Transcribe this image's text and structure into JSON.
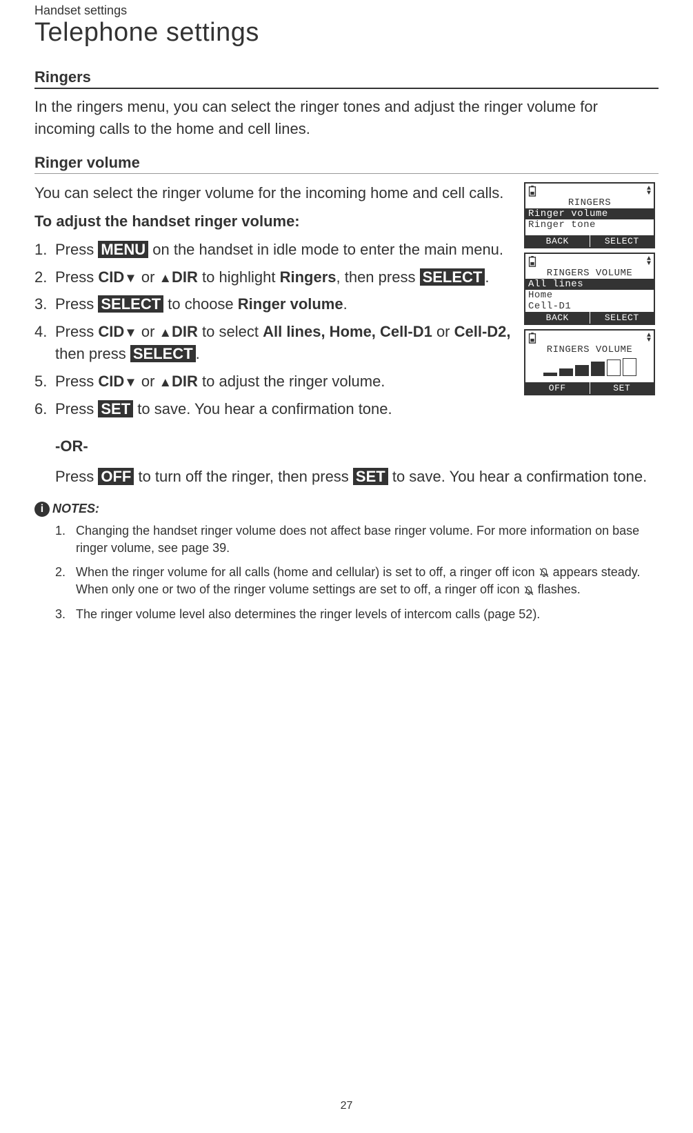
{
  "header": {
    "small": "Handset settings",
    "title": "Telephone settings"
  },
  "sections": {
    "ringers": {
      "heading": "Ringers",
      "intro": "In the ringers menu, you can select the ringer tones and adjust the ringer volume for incoming calls to the home and cell lines."
    },
    "ringer_volume": {
      "heading": "Ringer volume",
      "intro": "You can select the ringer volume for the incoming home and cell calls.",
      "adjust_heading": "To adjust the handset ringer volume:",
      "steps": {
        "s1a": "Press ",
        "s1_menu": "MENU",
        "s1b": " on the handset in idle mode to enter the main menu.",
        "s2a": "Press ",
        "s2_cid": "CID",
        "s2b": " or ",
        "s2_dir": "DIR",
        "s2c": " to highlight ",
        "s2_ringers": "Ringers",
        "s2d": ", then press ",
        "s2_select": "SELECT",
        "s2e": ".",
        "s3a": "Press ",
        "s3_select": "SELECT",
        "s3b": " to choose ",
        "s3_rv": "Ringer volume",
        "s3c": ".",
        "s4a": "Press ",
        "s4_cid": "CID",
        "s4b": " or ",
        "s4_dir": "DIR",
        "s4c": " to select ",
        "s4_opts": "All lines, Home, Cell-D1",
        "s4d": " or ",
        "s4_opts2": "Cell-D2,",
        "s4e": " then press ",
        "s4_select": "SELECT",
        "s4f": ".",
        "s5a": "Press ",
        "s5_cid": "CID",
        "s5b": " or ",
        "s5_dir": "DIR",
        "s5c": " to adjust the ringer volume.",
        "s6a": "Press ",
        "s6_set": "SET",
        "s6b": " to save. You hear a confirmation tone."
      },
      "or_label": "-OR-",
      "or_body_a": "Press ",
      "or_off": "OFF",
      "or_body_b": " to turn off the ringer, then press ",
      "or_set": "SET",
      "or_body_c": " to save. You hear a confirmation tone."
    }
  },
  "notes": {
    "label": "NOTES:",
    "n1": "Changing the handset ringer volume does not affect base ringer volume. For more information on base ringer volume, see page 39.",
    "n2a": "When the ringer volume for all calls (home and cellular) is set to off, a ringer off icon ",
    "n2b": " appears steady. When only one or two of the ringer volume settings are set to off, a ringer off icon ",
    "n2c": " flashes.",
    "n3": "The ringer volume level also determines the ringer levels of intercom calls (page 52)."
  },
  "lcd1": {
    "title": "RINGERS",
    "line1": "Ringer volume",
    "line2": "Ringer tone",
    "back": "BACK",
    "select": "SELECT"
  },
  "lcd2": {
    "title": "RINGERS VOLUME",
    "line1": "All lines",
    "line2": "Home",
    "line3": "Cell-D1",
    "back": "BACK",
    "select": "SELECT"
  },
  "lcd3": {
    "title": "RINGERS VOLUME",
    "off": "OFF",
    "set": "SET"
  },
  "page": "27"
}
